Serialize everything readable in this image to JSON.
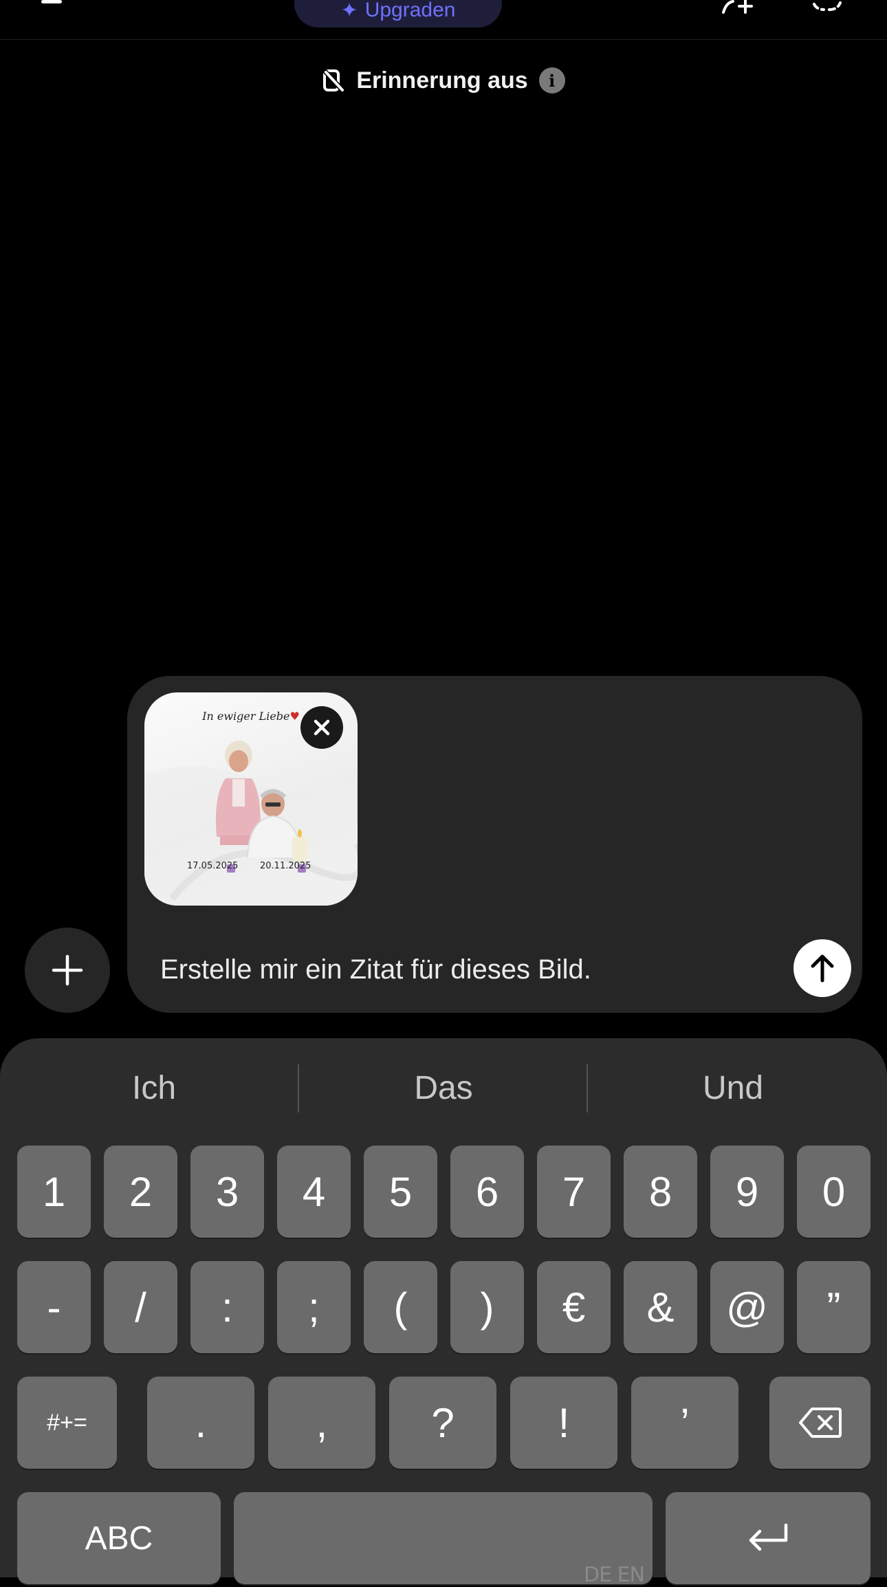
{
  "header": {
    "upgrade_label": "Upgraden",
    "memory_label": "Erinnerung aus",
    "info_glyph": "i"
  },
  "composer": {
    "attachment": {
      "title": "In ewiger Liebe",
      "date_left": "17.05.2025",
      "date_right": "20.11.2025"
    },
    "input_value": "Erstelle mir ein Zitat für dieses Bild."
  },
  "keyboard": {
    "suggestions": [
      "Ich",
      "Das",
      "Und"
    ],
    "row1": [
      "1",
      "2",
      "3",
      "4",
      "5",
      "6",
      "7",
      "8",
      "9",
      "0"
    ],
    "row2": [
      "-",
      "/",
      ":",
      ";",
      "(",
      ")",
      "€",
      "&",
      "@",
      "”"
    ],
    "row3_left": "#+=",
    "row3": [
      ".",
      ",",
      "?",
      "!",
      "’"
    ],
    "abc_label": "ABC",
    "space_lang": "DE EN"
  },
  "colors": {
    "accent": "#6f71ff",
    "composer_bg": "#262626",
    "keyboard_bg": "#2c2c2c",
    "key_bg": "#6b6b6b"
  },
  "icons": [
    "menu-icon",
    "sparkle-icon",
    "new-chat-icon",
    "temporary-chat-icon",
    "memory-off-icon",
    "info-icon",
    "plus-icon",
    "close-icon",
    "arrow-up-icon",
    "backspace-icon",
    "return-icon"
  ]
}
